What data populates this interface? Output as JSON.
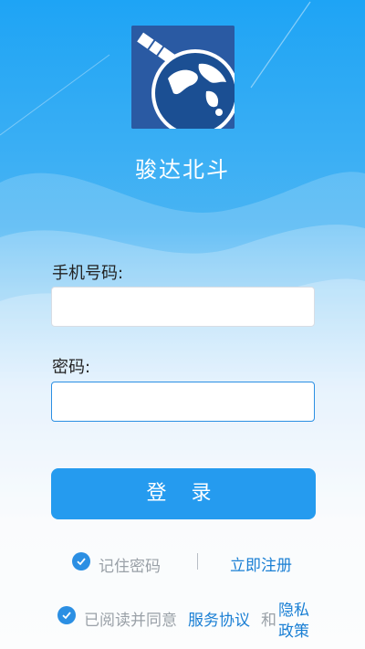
{
  "app": {
    "title": "骏达北斗"
  },
  "form": {
    "phone_label": "手机号码:",
    "phone_value": "",
    "password_label": "密码:",
    "password_value": ""
  },
  "actions": {
    "login_label": "登 录",
    "remember_label": "记住密码",
    "separator": "|",
    "register_label": "立即注册"
  },
  "agreement": {
    "prefix": "已阅读并同意",
    "service_link": "服务协议",
    "and": "和",
    "privacy_line1": "隐私",
    "privacy_line2": "政策"
  },
  "colors": {
    "accent": "#259bef",
    "link": "#1a7fd4",
    "logo_bg": "#2a5aa3"
  },
  "icons": {
    "logo": "satellite-globe-icon",
    "check": "checkmark-circle-icon"
  }
}
